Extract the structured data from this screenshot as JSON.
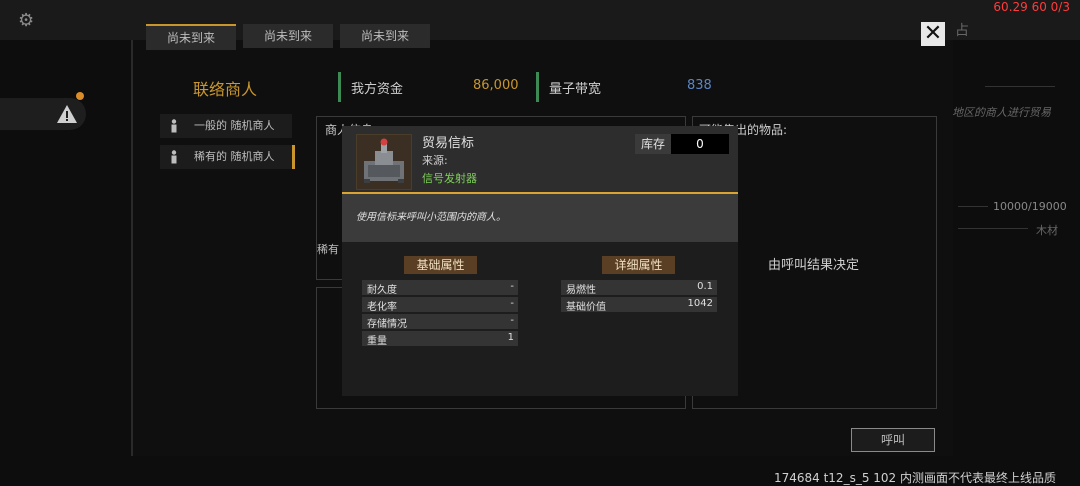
{
  "overlay": {
    "fps_text": "60.29 60 0/3"
  },
  "tabs": [
    "尚未到来",
    "尚未到来",
    "尚未到来"
  ],
  "merchants": {
    "title": "联络商人",
    "items": [
      "一般的 随机商人",
      "稀有的 随机商人"
    ],
    "selected_index": 1
  },
  "stats": {
    "funds_label": "我方资金",
    "funds_value": "86,000",
    "bandwidth_label": "量子带宽",
    "bandwidth_value": "838"
  },
  "panels": {
    "merchant_info_title": "商人信息",
    "sellable_title": "可能售出的物品:",
    "rare_label": "稀有",
    "result_text": "由呼叫结果决定"
  },
  "call_button": "呼叫",
  "build_text": "174684 t12_s_5 102  内测画面不代表最终上线品质",
  "background": {
    "right_char": "占",
    "right_desc": "地区的商人进行贸易",
    "right_counter": "10000/19000",
    "right_item": "木材"
  },
  "tooltip": {
    "title": "贸易信标",
    "source_label": "来源:",
    "source_value": "信号发射器",
    "stock_label": "库存",
    "stock_value": "0",
    "description": "使用信标来呼叫小范围内的商人。",
    "basic_header": "基础属性",
    "detail_header": "详细属性",
    "basic_rows": [
      {
        "key": "耐久度",
        "value": "-"
      },
      {
        "key": "老化率",
        "value": "-"
      },
      {
        "key": "存储情况",
        "value": "-"
      },
      {
        "key": "重量",
        "value": "1"
      }
    ],
    "detail_rows": [
      {
        "key": "易燃性",
        "value": "0.1"
      },
      {
        "key": "基础价值",
        "value": "1042"
      }
    ]
  },
  "colors": {
    "accent_gold": "#c9962e",
    "funds_value": "#c9962e",
    "bandwidth_value": "#5b86c4",
    "source_green": "#7fcf5a",
    "fps_red": "#ff3b3b"
  }
}
